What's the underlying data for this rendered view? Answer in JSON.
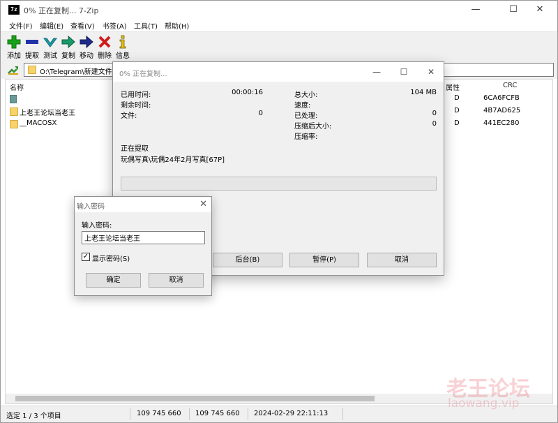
{
  "window": {
    "app_icon_text": "7z",
    "title": "0% 正在复制... 7-Zip",
    "min": "—",
    "max": "☐",
    "close": "✕"
  },
  "menu": [
    "文件(F)",
    "编辑(E)",
    "查看(V)",
    "书签(A)",
    "工具(T)",
    "帮助(H)"
  ],
  "toolbar": {
    "add": "添加",
    "extract": "提取",
    "test": "测试",
    "copy": "复制",
    "move": "移动",
    "delete": "删除",
    "info": "信息"
  },
  "address": {
    "path": "O:\\Telegram\\新建文件夹"
  },
  "columns": {
    "name": "名称",
    "attr": "属性",
    "crc": "CRC"
  },
  "files": [
    {
      "name": "",
      "attr": "D",
      "crc": "6CA6FCFB"
    },
    {
      "name": "上老王论坛当老王",
      "attr": "D",
      "crc": "4B7AD625"
    },
    {
      "name": "__MACOSX",
      "attr": "D",
      "crc": "441EC280"
    }
  ],
  "status": {
    "selection": "选定 1 / 3 个项目",
    "size1": "109 745 660",
    "size2": "109 745 660",
    "date": "2024-02-29 22:11:13"
  },
  "progress": {
    "title": "0% 正在复制...",
    "elapsed_label": "已用时间:",
    "elapsed_value": "00:00:16",
    "remaining_label": "剩余时间:",
    "files_label": "文件:",
    "files_value": "0",
    "total_size_label": "总大小:",
    "total_size_value": "104 MB",
    "speed_label": "速度:",
    "processed_label": "已处理:",
    "processed_value": "0",
    "compressed_label": "压缩后大小:",
    "compressed_value": "0",
    "ratio_label": "压缩率:",
    "operation": "正在提取",
    "current_file": "玩偶写真\\玩偶24年2月写真[67P]",
    "percent": 0,
    "background_button": "后台(B)",
    "pause_button": "暂停(P)",
    "cancel_button": "取消"
  },
  "password_dialog": {
    "title": "输入密码",
    "label": "输入密码:",
    "value": "上老王论坛当老王",
    "show_password": "显示密码(S)",
    "ok": "确定",
    "cancel": "取消"
  },
  "watermark": {
    "text": "老王论坛",
    "url": "laowang.vip"
  },
  "colors": {
    "add_green": "#1aa11a",
    "extract_blue": "#2233aa",
    "test_teal": "#1a9aa8",
    "delete_red": "#d11a1a",
    "info_yellow": "#e3c21c",
    "folder_yellow": "#f6d36b",
    "progress_green": "#06b025"
  }
}
